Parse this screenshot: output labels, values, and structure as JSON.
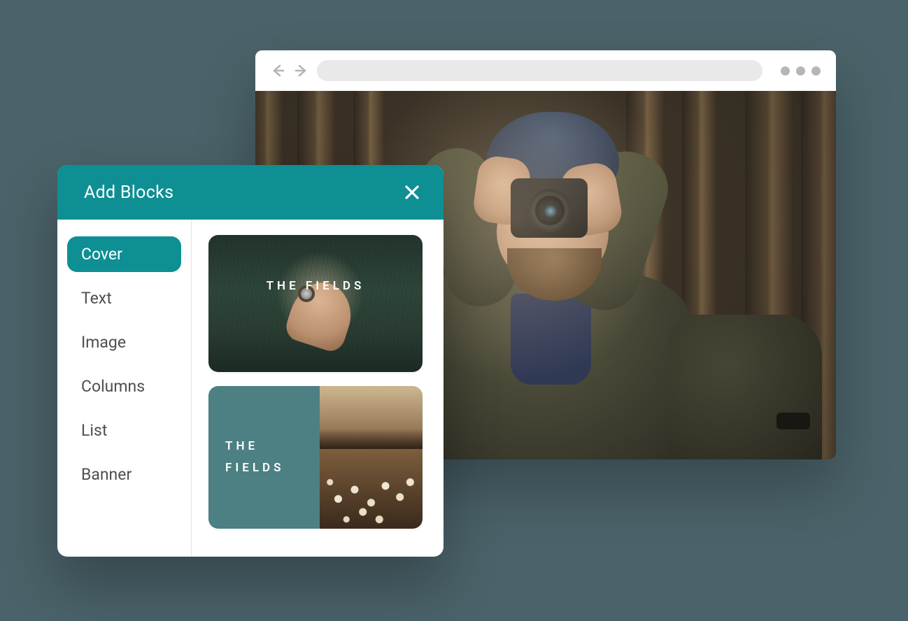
{
  "panel": {
    "title": "Add Blocks",
    "categories": [
      {
        "label": "Cover",
        "active": true
      },
      {
        "label": "Text",
        "active": false
      },
      {
        "label": "Image",
        "active": false
      },
      {
        "label": "Columns",
        "active": false
      },
      {
        "label": "List",
        "active": false
      },
      {
        "label": "Banner",
        "active": false
      }
    ],
    "previews": [
      {
        "title": "THE FIELDS"
      },
      {
        "title_line1": "THE",
        "title_line2": "FIELDS"
      }
    ]
  }
}
